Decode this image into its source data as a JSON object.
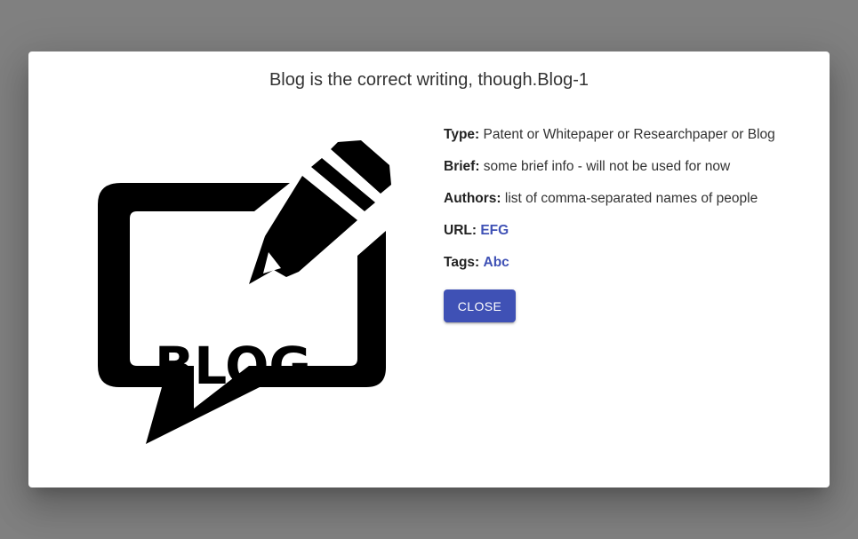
{
  "dialog": {
    "title": "Blog is the correct writing, though.Blog-1",
    "image": {
      "icon": "blog-speech-bubble-pencil-icon",
      "text": "BLOG"
    },
    "details": {
      "type_label": "Type:",
      "type_value": "Patent or Whitepaper or Researchpaper or Blog",
      "brief_label": "Brief:",
      "brief_value": "some brief info - will not be used for now",
      "authors_label": "Authors:",
      "authors_value": "list of comma-separated names of people",
      "url_label": "URL:",
      "url_value": "EFG",
      "tags_label": "Tags:",
      "tags_value": "Abc"
    },
    "close_label": "CLOSE"
  },
  "colors": {
    "backdrop": "#808080",
    "primary": "#3f51b5",
    "text": "#333333"
  }
}
